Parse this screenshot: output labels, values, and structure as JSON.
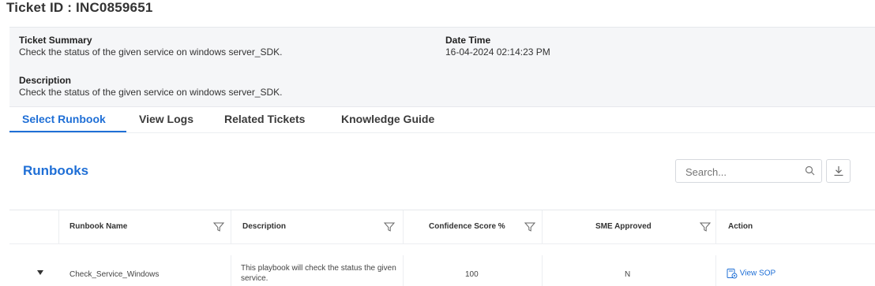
{
  "ticket": {
    "title": "Ticket ID : INC0859651"
  },
  "summary": {
    "summary_label": "Ticket Summary",
    "summary_value": "Check the status of the given service on windows server_SDK.",
    "datetime_label": "Date Time",
    "datetime_value": "16-04-2024 02:14:23 PM",
    "description_label": "Description",
    "description_value": "Check the status of the given service on windows server_SDK."
  },
  "tabs": [
    {
      "label": "Select Runbook",
      "active": true
    },
    {
      "label": "View Logs",
      "active": false
    },
    {
      "label": "Related Tickets",
      "active": false
    },
    {
      "label": "Knowledge Guide",
      "active": false
    }
  ],
  "runbooks": {
    "title": "Runbooks",
    "search_placeholder": "Search...",
    "columns": [
      "Runbook Name",
      "Description",
      "Confidence Score %",
      "SME Approved",
      "Action"
    ],
    "rows": [
      {
        "name": "Check_Service_Windows",
        "description": "This playbook will check the status the given service.",
        "confidence": "100",
        "sme_approved": "N",
        "action": "View SOP"
      }
    ]
  },
  "icons": {
    "search": "search-icon",
    "download": "download-icon",
    "filter": "filter-icon",
    "expand": "caret-down-icon",
    "view_sop": "document-view-icon"
  },
  "colors": {
    "accent": "#1f6fd6",
    "panel": "#f5f6f8",
    "border": "#e6e8ec"
  }
}
